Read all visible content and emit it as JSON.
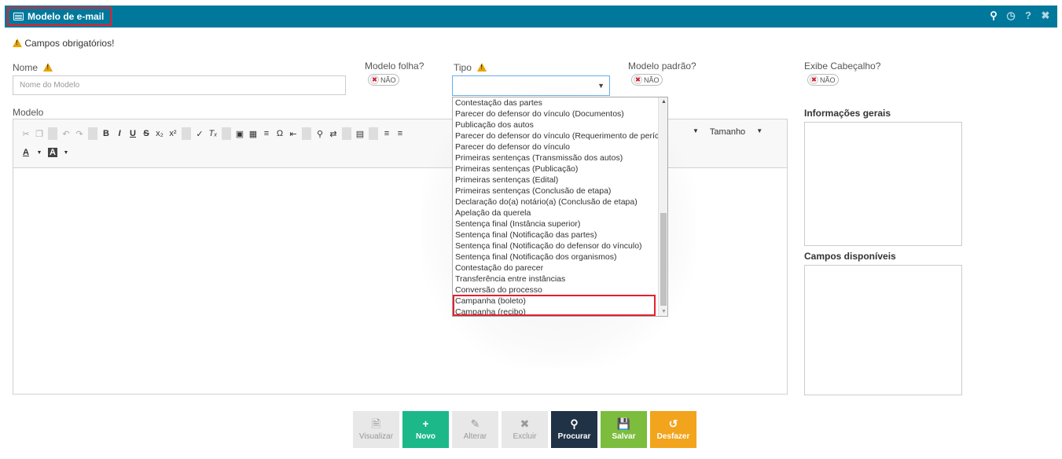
{
  "window": {
    "title": "Modelo de e-mail",
    "actions": [
      "search-icon",
      "clock-icon",
      "help-icon",
      "close-icon"
    ],
    "header_color": "#00789c"
  },
  "required_notice": "Campos obrigatórios!",
  "form": {
    "nome_label": "Nome",
    "nome_placeholder": "Nome do Modelo",
    "modelo_folha_label": "Modelo folha?",
    "modelo_folha_value": "NÃO",
    "tipo_label": "Tipo",
    "modelo_padrao_label": "Modelo padrão?",
    "modelo_padrao_value": "NÃO",
    "exibe_cabecalho_label": "Exibe Cabeçalho?",
    "exibe_cabecalho_value": "NÃO",
    "modelo_label": "Modelo"
  },
  "editor": {
    "size_label": "Tamanho"
  },
  "side": {
    "info_title": "Informações gerais",
    "campos_title": "Campos disponíveis"
  },
  "tipo_options": [
    "Contestação das partes",
    "Parecer do defensor do vínculo (Documentos)",
    "Publicação dos autos",
    "Parecer do defensor do vínculo (Requerimento de perícia)",
    "Parecer do defensor do vínculo",
    "Primeiras sentenças (Transmissão dos autos)",
    "Primeiras sentenças (Publicação)",
    "Primeiras sentenças (Edital)",
    "Primeiras sentenças (Conclusão de etapa)",
    "Declaração do(a) notário(a) (Conclusão de etapa)",
    "Apelação da querela",
    "Sentença final (Instância superior)",
    "Sentença final (Notificação das partes)",
    "Sentença final (Notificação do defensor do vínculo)",
    "Sentença final (Notificação dos organismos)",
    "Contestação do parecer",
    "Transferência entre instâncias",
    "Conversão do processo",
    "Campanha (boleto)",
    "Campanha (recibo)"
  ],
  "buttons": {
    "visualizar": "Visualizar",
    "novo": "Novo",
    "alterar": "Alterar",
    "excluir": "Excluir",
    "procurar": "Procurar",
    "salvar": "Salvar",
    "desfazer": "Desfazer"
  },
  "colors": {
    "novo": "#1cb88a",
    "procurar": "#203246",
    "salvar": "#7cbd3d",
    "desfazer": "#f2a41d",
    "highlight": "#e5202e"
  }
}
